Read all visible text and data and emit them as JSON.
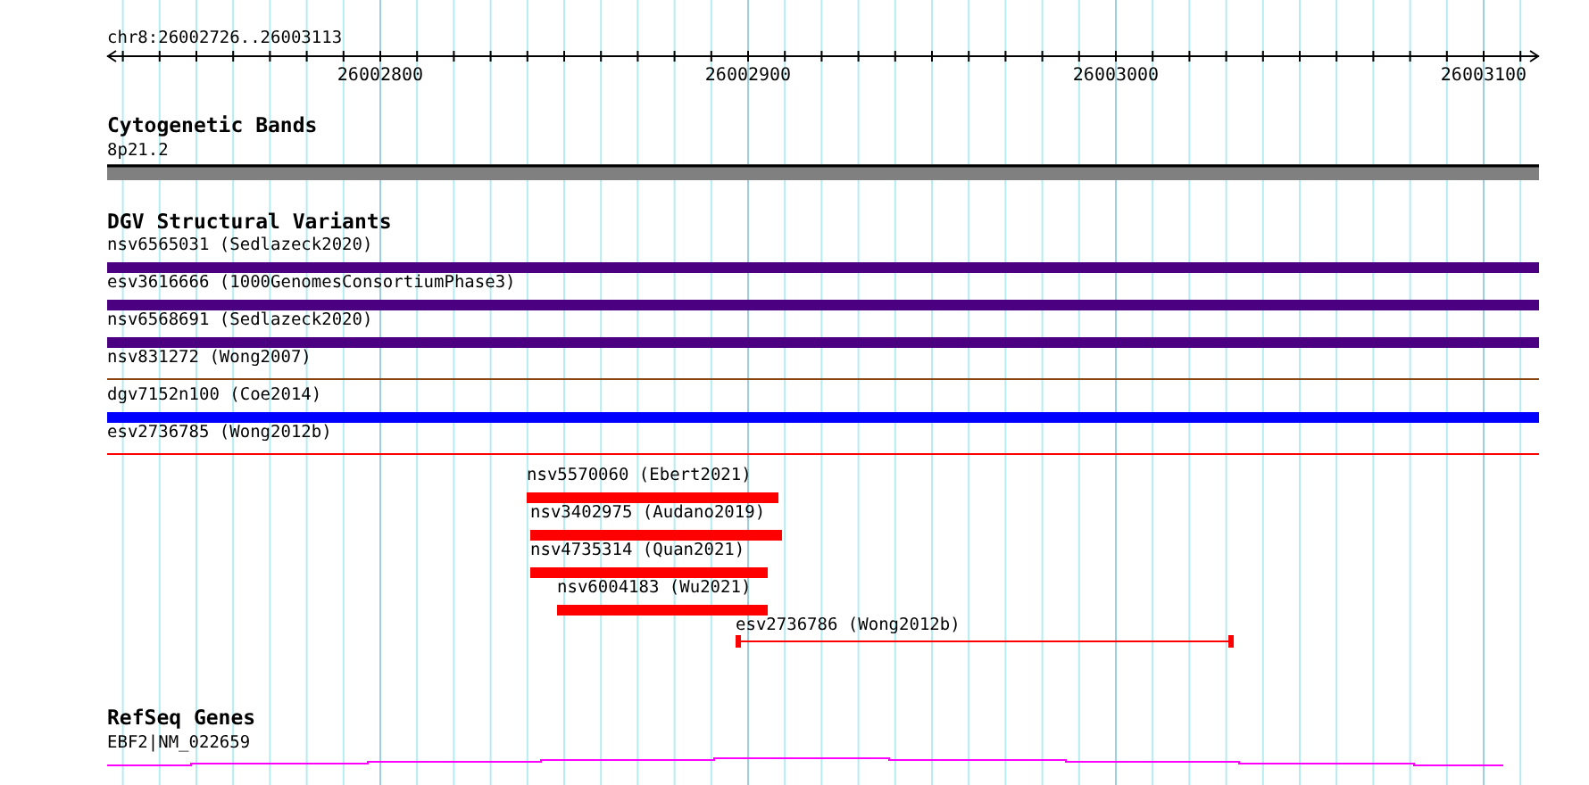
{
  "ruler": {
    "location": "chr8:26002726..26003113",
    "ticks": [
      "26002800",
      "26002900",
      "26003000",
      "26003100"
    ]
  },
  "tracks": [
    {
      "title": "Cytogenetic Bands",
      "kind": "band",
      "features": [
        {
          "label": "8p21.2",
          "kind": "band",
          "color": "#808080"
        }
      ]
    },
    {
      "title": "DGV Structural Variants",
      "kind": "variants",
      "features": [
        {
          "label": "nsv6565031 (Sedlazeck2020)",
          "kind": "bar",
          "color": "#4b0082"
        },
        {
          "label": "esv3616666 (1000GenomesConsortiumPhase3)",
          "kind": "bar",
          "color": "#4b0082"
        },
        {
          "label": "nsv6568691 (Sedlazeck2020)",
          "kind": "bar",
          "color": "#4b0082"
        },
        {
          "label": "nsv831272 (Wong2007)",
          "kind": "line",
          "color": "#8b4513"
        },
        {
          "label": "dgv7152n100 (Coe2014)",
          "kind": "bar",
          "color": "#0000ff"
        },
        {
          "label": "esv2736785 (Wong2012b)",
          "kind": "line",
          "color": "#ff0000"
        },
        {
          "label": "nsv5570060 (Ebert2021)",
          "kind": "bar",
          "color": "#ff0000"
        },
        {
          "label": "nsv3402975 (Audano2019)",
          "kind": "bar",
          "color": "#ff0000"
        },
        {
          "label": "nsv4735314 (Quan2021)",
          "kind": "bar",
          "color": "#ff0000"
        },
        {
          "label": "nsv6004183 (Wu2021)",
          "kind": "bar",
          "color": "#ff0000"
        },
        {
          "label": "esv2736786 (Wong2012b)",
          "kind": "interval",
          "color": "#ff0000"
        }
      ]
    },
    {
      "title": "RefSeq Genes",
      "kind": "gene",
      "features": [
        {
          "label": "EBF2|NM_022659",
          "kind": "gene",
          "color": "#ff00ff"
        }
      ]
    }
  ]
}
